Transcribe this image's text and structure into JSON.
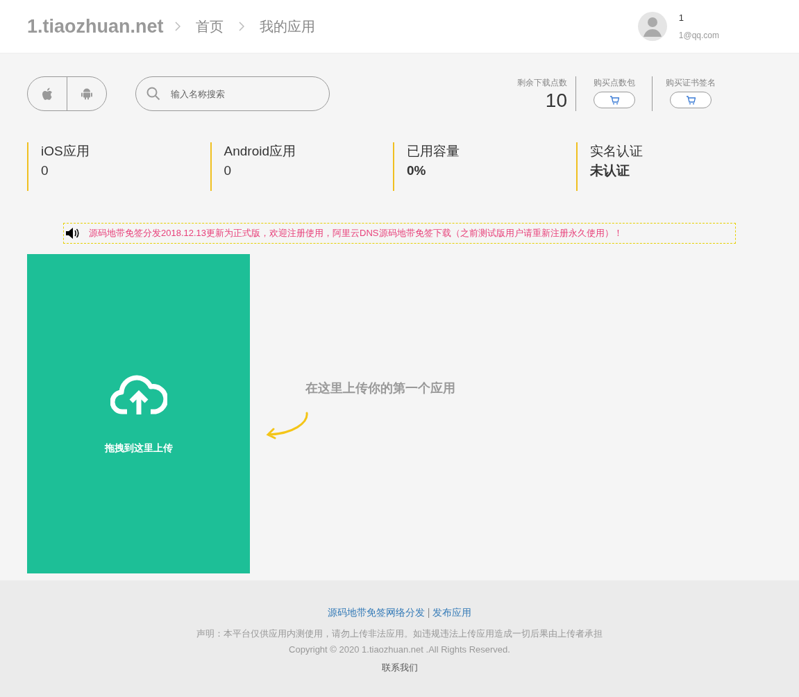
{
  "header": {
    "logo": "1.tiaozhuan.net",
    "breadcrumb": [
      "首页",
      "我的应用"
    ],
    "user": {
      "name": "1",
      "email": "1@qq.com"
    }
  },
  "toolbar": {
    "search": {
      "placeholder": "输入名称搜索"
    },
    "points": {
      "label": "剩余下载点数",
      "value": "10"
    },
    "shop": [
      {
        "label": "购买点数包"
      },
      {
        "label": "购买证书签名"
      }
    ]
  },
  "stats": [
    {
      "label": "iOS应用",
      "value": "0",
      "bold": false
    },
    {
      "label": "Android应用",
      "value": "0",
      "bold": false
    },
    {
      "label": "已用容量",
      "value": "0%",
      "bold": true
    },
    {
      "label": "实名认证",
      "value": "未认证",
      "bold": true
    }
  ],
  "notice": "源码地带免签分发2018.12.13更新为正式版，欢迎注册使用，阿里云DNS源码地带免签下载（之前测试版用户请重新注册永久使用）！",
  "upload": {
    "label": "拖拽到这里上传",
    "hint": "在这里上传你的第一个应用"
  },
  "footer": {
    "links": [
      "源码地带免签网络分发",
      "发布应用"
    ],
    "separator": "|",
    "disclaimer": "声明：本平台仅供应用内测使用，请勿上传非法应用。如违规违法上传应用造成一切后果由上传者承担",
    "copyright": "Copyright © 2020 1.tiaozhuan.net .All Rights Reserved.",
    "contact": "联系我们"
  }
}
